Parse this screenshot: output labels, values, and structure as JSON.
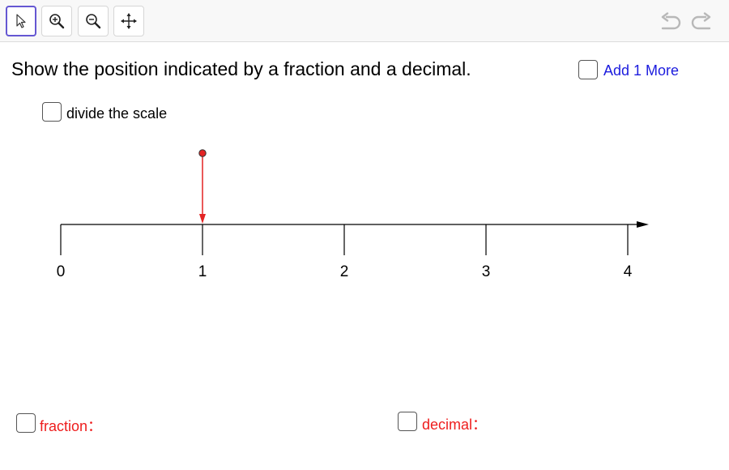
{
  "toolbar": {
    "tools": [
      {
        "name": "move-tool",
        "icon": "arrow-pointer-icon",
        "selected": true
      },
      {
        "name": "zoom-in-tool",
        "icon": "zoom-in-icon",
        "selected": false
      },
      {
        "name": "zoom-out-tool",
        "icon": "zoom-out-icon",
        "selected": false
      },
      {
        "name": "move-graphics-view-tool",
        "icon": "move-arrows-icon",
        "selected": false
      }
    ],
    "undo_icon": "undo-icon",
    "redo_icon": "redo-icon"
  },
  "question": "Show the position indicated by a fraction and a decimal.",
  "checkboxes": {
    "add_more": {
      "label": "Add 1 More",
      "checked": false
    },
    "divide_scale": {
      "label": "divide the scale",
      "checked": false
    },
    "fraction": {
      "label": "fraction：",
      "checked": false
    },
    "decimal": {
      "label": "decimal：",
      "checked": false
    }
  },
  "number_line": {
    "min": 0,
    "max": 4,
    "ticks": [
      "0",
      "1",
      "2",
      "3",
      "4"
    ],
    "pointer_value": 1
  },
  "colors": {
    "selected_tool_border": "#6557d2",
    "pointer": "#e32323",
    "label_red": "#ee1d1d",
    "label_blue": "#1c1cde"
  }
}
